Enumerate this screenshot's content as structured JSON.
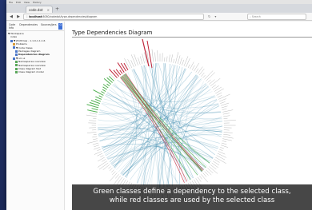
{
  "browser": {
    "menu": [
      "File",
      "Edit",
      "View",
      "History"
    ],
    "tab_title": "code.dot",
    "tab_close": "×",
    "new_tab": "+",
    "url_host": "localhost",
    "url_path": ":8080/codedot/type-dependencies/diagram",
    "search_placeholder": "Search"
  },
  "sidebar": {
    "tabs": [
      "Code Info",
      "Dependencies",
      "Sources/jars",
      "Q"
    ],
    "active_tab": 3,
    "tree": [
      {
        "label": "▼ Workspace",
        "indent": 0,
        "bold": false,
        "icon": "none"
      },
      {
        "label": "index",
        "indent": 1,
        "bold": false,
        "icon": "none"
      },
      {
        "label": "▼ JHotDraw - 1.1.0-1.1.1.6",
        "indent": 1,
        "bold": false,
        "icon": "blue"
      },
      {
        "label": "Problems",
        "indent": 2,
        "bold": false,
        "icon": "orange"
      },
      {
        "label": "▼ Code Views",
        "indent": 2,
        "bold": false,
        "icon": "blue"
      },
      {
        "label": "Packages diagram",
        "indent": 3,
        "bold": false,
        "icon": "blue"
      },
      {
        "label": "Dependencies diagram",
        "indent": 3,
        "bold": true,
        "icon": "blue"
      },
      {
        "label": "▼ src.ui",
        "indent": 2,
        "bold": false,
        "icon": "blue"
      },
      {
        "label": "Namespaces overview",
        "indent": 3,
        "bold": false,
        "icon": "green"
      },
      {
        "label": "Namespaces overview",
        "indent": 3,
        "bold": false,
        "icon": "green"
      },
      {
        "label": "Class diagram fast",
        "indent": 3,
        "bold": false,
        "icon": "green"
      },
      {
        "label": "Class diagram model",
        "indent": 3,
        "bold": false,
        "icon": "green"
      }
    ]
  },
  "main": {
    "title": "Type Dependencies Diagram"
  },
  "diagram": {
    "highlight_green": "#4fb04f",
    "highlight_red": "#c0263b",
    "edge_blue": "#3f8db0"
  },
  "caption": {
    "line1": "Green classes define a dependency to the selected class,",
    "line2": "while red classes are used by the selected class"
  }
}
